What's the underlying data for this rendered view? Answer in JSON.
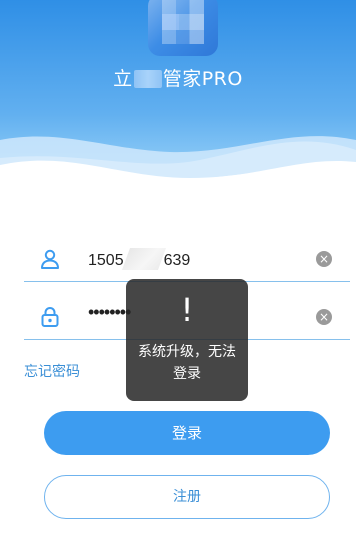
{
  "header": {
    "title_prefix": "立",
    "title_suffix": "管家PRO",
    "gradient_top": "#2f8fe6",
    "gradient_bottom": "#8ccaf6"
  },
  "login_form": {
    "phone_prefix": "1505",
    "phone_suffix": "639",
    "password_mask": "••••••••",
    "clear_symbol": "×",
    "forgot_password_label": "忘记密码"
  },
  "buttons": {
    "login_label": "登录",
    "register_label": "注册"
  },
  "toast": {
    "icon": "!",
    "message": "系统升级，无法登录"
  },
  "colors": {
    "accent": "#3d9cf0",
    "link": "#3b8fd6",
    "divider": "#86c0ec"
  }
}
